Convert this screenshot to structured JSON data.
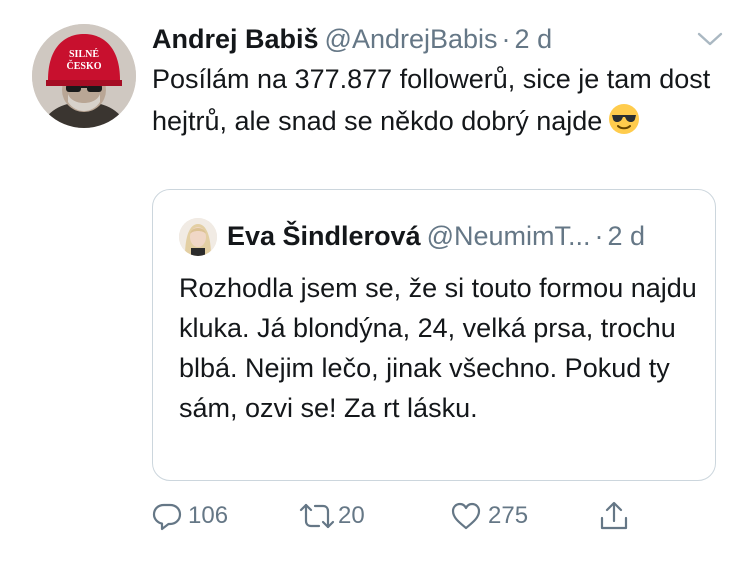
{
  "tweet": {
    "author": {
      "name": "Andrej Babiš",
      "handle": "@AndrejBabis",
      "avatar_cap_text_line1": "SILNÉ",
      "avatar_cap_text_line2": "ČESKO"
    },
    "separator": "·",
    "time": "2 d",
    "text": "Posílám na 377.877 followerů, sice je tam dost hejtrů, ale snad se někdo dobrý najde",
    "emoji": "smiling-face-with-sunglasses",
    "menu_icon": "chevron-down-icon",
    "quoted": {
      "author": {
        "name": "Eva Šindlerová",
        "handle": "@NeumimT..."
      },
      "separator": "·",
      "time": "2 d",
      "text": "Rozhodla jsem se, že si touto formou najdu kluka. Já blondýna, 24, velká prsa, trochu blbá. Nejim lečo, jinak všechno. Pokud ty sám, ozvi se! Za rt lásku."
    },
    "actions": {
      "reply": {
        "icon": "reply-icon",
        "count": "106"
      },
      "retweet": {
        "icon": "retweet-icon",
        "count": "20"
      },
      "like": {
        "icon": "heart-icon",
        "count": "275"
      },
      "share": {
        "icon": "share-icon"
      }
    }
  },
  "colors": {
    "text": "#14171a",
    "secondary": "#657786",
    "border": "#ccd6dd",
    "cap_red": "#c8102e"
  }
}
